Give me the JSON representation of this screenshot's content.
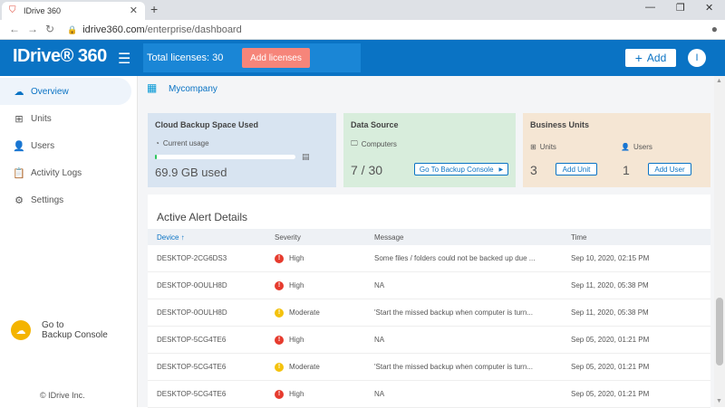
{
  "browser": {
    "tab_title": "IDrive 360",
    "url_domain": "idrive360.com",
    "url_path": "/enterprise/dashboard"
  },
  "header": {
    "logo": "IDrive® 360",
    "total_licenses": "Total licenses: 30",
    "add_licenses": "Add licenses",
    "add_button": "Add",
    "avatar_letter": "I"
  },
  "sidebar": {
    "items": [
      {
        "label": "Overview",
        "icon": "cloud-icon"
      },
      {
        "label": "Units",
        "icon": "grid-icon"
      },
      {
        "label": "Users",
        "icon": "user-icon"
      },
      {
        "label": "Activity Logs",
        "icon": "clipboard-icon"
      },
      {
        "label": "Settings",
        "icon": "gear-icon"
      }
    ],
    "goto_line1": "Go to",
    "goto_line2": "Backup Console",
    "copyright": "© IDrive Inc."
  },
  "main": {
    "company": "Mycompany",
    "cloud_card": {
      "title": "Cloud Backup Space Used",
      "sub": "Current usage",
      "value": "69.9 GB used",
      "usage_fraction": 0.01
    },
    "data_card": {
      "title": "Data Source",
      "sub": "Computers",
      "value": "7 / 30",
      "button": "Go To Backup Console"
    },
    "units_card": {
      "title": "Business Units",
      "units_label": "Units",
      "units_value": "3",
      "add_unit": "Add Unit",
      "users_label": "Users",
      "users_value": "1",
      "add_user": "Add User"
    },
    "alerts": {
      "title": "Active Alert Details",
      "columns": [
        "Device ↑",
        "Severity",
        "Message",
        "Time"
      ],
      "rows": [
        {
          "device": "DESKTOP-2CG6DS3",
          "severity": "High",
          "message": "Some files / folders could not be backed up due ...",
          "time": "Sep 10, 2020, 02:15 PM"
        },
        {
          "device": "DESKTOP-0OULH8D",
          "severity": "High",
          "message": "NA",
          "time": "Sep 11, 2020, 05:38 PM"
        },
        {
          "device": "DESKTOP-0OULH8D",
          "severity": "Moderate",
          "message": "'Start the missed backup when computer is turn...",
          "time": "Sep 11, 2020, 05:38 PM"
        },
        {
          "device": "DESKTOP-5CG4TE6",
          "severity": "High",
          "message": "NA",
          "time": "Sep 05, 2020, 01:21 PM"
        },
        {
          "device": "DESKTOP-5CG4TE6",
          "severity": "Moderate",
          "message": "'Start the missed backup when computer is turn...",
          "time": "Sep 05, 2020, 01:21 PM"
        },
        {
          "device": "DESKTOP-5CG4TE6",
          "severity": "High",
          "message": "NA",
          "time": "Sep 05, 2020, 01:21 PM"
        }
      ]
    }
  },
  "colors": {
    "brand": "#0a73c4",
    "high": "#e63b2e",
    "moderate": "#f4c20d",
    "accent_button": "#f6857a"
  }
}
